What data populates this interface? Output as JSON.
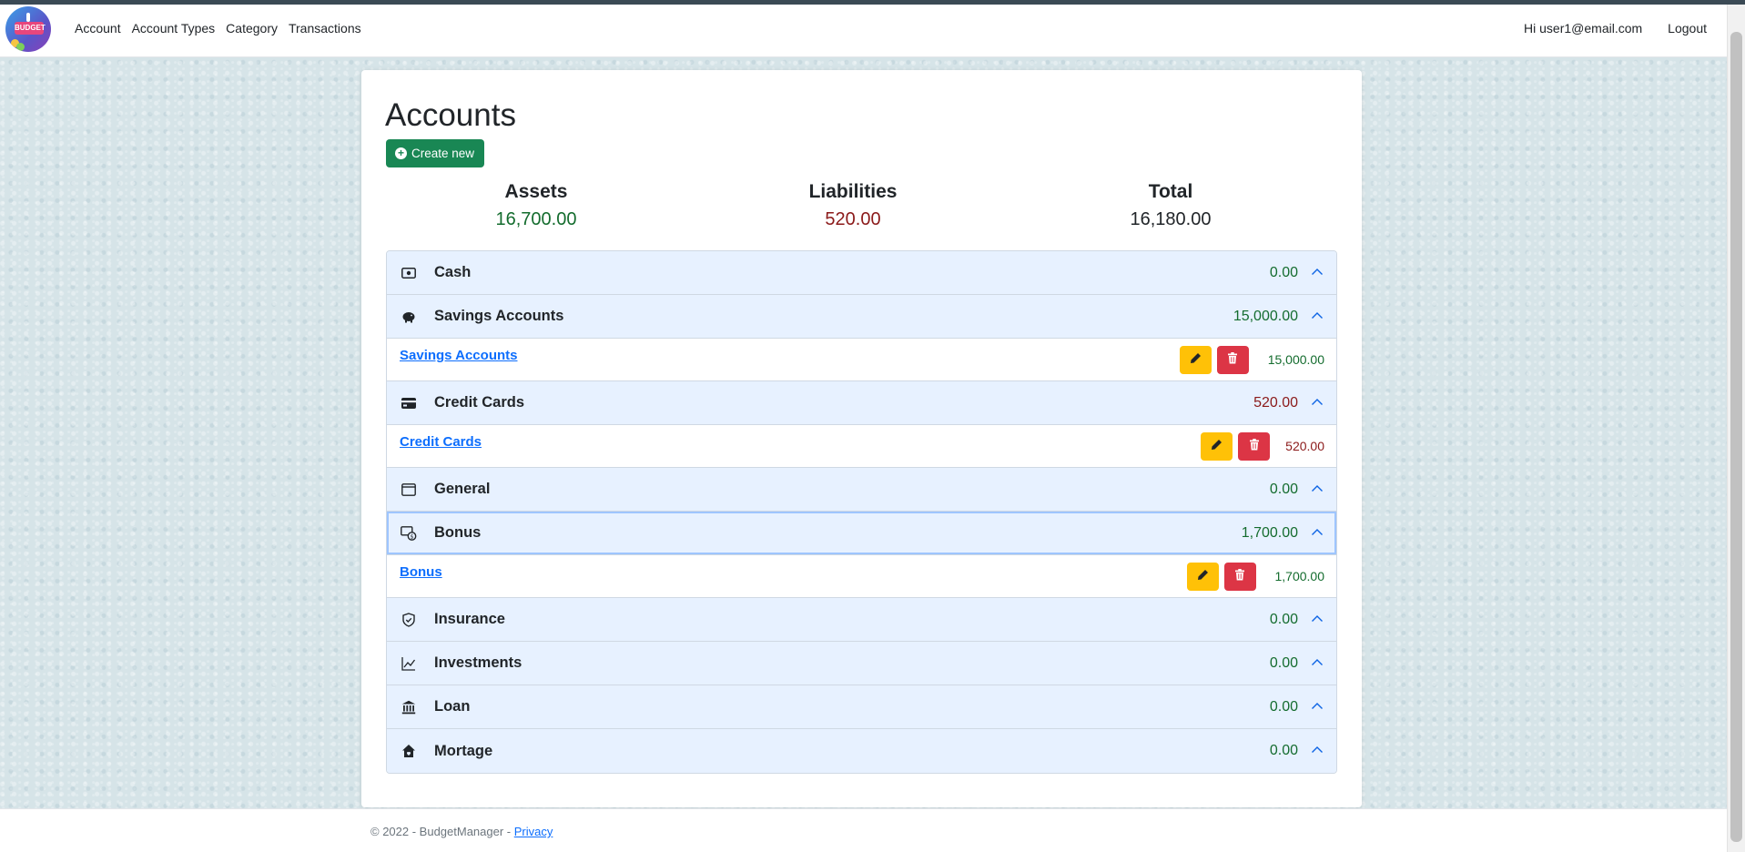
{
  "nav": {
    "logo_text": "BUDGET",
    "links": [
      "Account",
      "Account Types",
      "Category",
      "Transactions"
    ],
    "greeting": "Hi user1@email.com",
    "logout": "Logout"
  },
  "page": {
    "title": "Accounts",
    "create_label": "Create new"
  },
  "summary": {
    "assets_label": "Assets",
    "assets_value": "16,700.00",
    "liabilities_label": "Liabilities",
    "liabilities_value": "520.00",
    "total_label": "Total",
    "total_value": "16,180.00"
  },
  "groups": [
    {
      "title": "Cash",
      "amount": "0.00",
      "amount_color": "green",
      "icon": "cash-icon",
      "accounts": []
    },
    {
      "title": "Savings Accounts",
      "amount": "15,000.00",
      "amount_color": "green",
      "icon": "piggy-bank-icon",
      "accounts": [
        {
          "name": "Savings Accounts",
          "balance": "15,000.00",
          "color": "green"
        }
      ]
    },
    {
      "title": "Credit Cards",
      "amount": "520.00",
      "amount_color": "red",
      "icon": "credit-card-icon",
      "accounts": [
        {
          "name": "Credit Cards",
          "balance": "520.00",
          "color": "red"
        }
      ]
    },
    {
      "title": "General",
      "amount": "0.00",
      "amount_color": "green",
      "icon": "window-icon",
      "accounts": []
    },
    {
      "title": "Bonus",
      "amount": "1,700.00",
      "amount_color": "green",
      "icon": "cash-coin-icon",
      "focused": true,
      "accounts": [
        {
          "name": "Bonus",
          "balance": "1,700.00",
          "color": "green"
        }
      ]
    },
    {
      "title": "Insurance",
      "amount": "0.00",
      "amount_color": "green",
      "icon": "shield-check-icon",
      "accounts": []
    },
    {
      "title": "Investments",
      "amount": "0.00",
      "amount_color": "green",
      "icon": "graph-up-icon",
      "accounts": []
    },
    {
      "title": "Loan",
      "amount": "0.00",
      "amount_color": "green",
      "icon": "bank-icon",
      "accounts": []
    },
    {
      "title": "Mortage",
      "amount": "0.00",
      "amount_color": "green",
      "icon": "house-heart-icon",
      "accounts": []
    }
  ],
  "footer": {
    "copyright": "© 2022 - BudgetManager - ",
    "privacy": "Privacy"
  },
  "colors": {
    "primary_green": "#198754",
    "asset_green": "#146c2e",
    "liability_red": "#8b1a1a",
    "edit_yellow": "#ffc107",
    "delete_red": "#dc3545",
    "accordion_bg": "#e7f1ff",
    "link_blue": "#0d6efd"
  }
}
